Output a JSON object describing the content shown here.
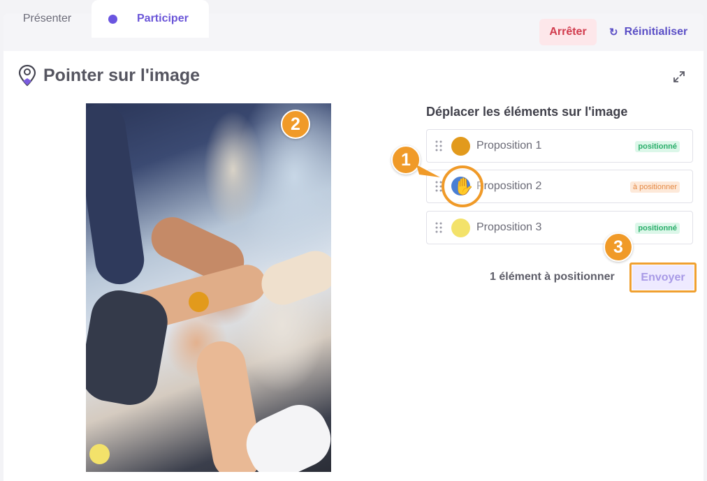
{
  "tabs": {
    "present": "Présenter",
    "participate": "Participer"
  },
  "header": {
    "stop_label": "Arrêter",
    "reset_label": "Réinitialiser"
  },
  "activity": {
    "title": "Pointer sur l'image",
    "icon": "map-pin-icon"
  },
  "panel": {
    "title": "Déplacer les éléments sur l'image",
    "items": [
      {
        "label": "Proposition 1",
        "color": "#e29a1c",
        "status": "positionné"
      },
      {
        "label": "Proposition 2",
        "color": "#4a7fd4",
        "status": "à positionner"
      },
      {
        "label": "Proposition 3",
        "color": "#f3e26a",
        "status": "positionné"
      }
    ],
    "remaining_text": "1 élément à positionner",
    "send_label": "Envoyer"
  },
  "annotations": {
    "step1": "1",
    "step2": "2",
    "step3": "3"
  },
  "colors": {
    "accent": "#6a55d8",
    "stop": "#d13b4d",
    "annotation": "#f09a28"
  }
}
